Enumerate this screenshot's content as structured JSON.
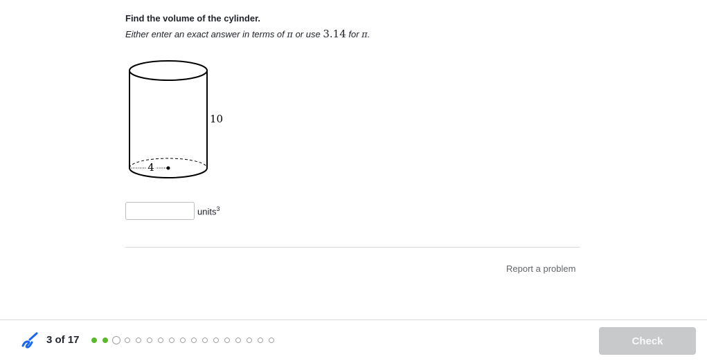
{
  "question": {
    "title": "Find the volume of the cylinder.",
    "instruction_prefix": "Either enter an exact answer in terms of",
    "pi_symbol": "π",
    "instruction_middle": "or use",
    "pi_approx": "3.14",
    "instruction_for": "for",
    "instruction_end": "."
  },
  "figure": {
    "height_label": "10",
    "radius_label": "4"
  },
  "answer": {
    "value": "",
    "placeholder": "",
    "units_label": "units",
    "units_exponent": "3"
  },
  "report_link": "Report a problem",
  "footer": {
    "progress_text": "3 of 17",
    "progress": {
      "current": 3,
      "total": 17,
      "completed": 2
    },
    "check_label": "Check",
    "colors": {
      "completed_dot": "#5cb82f",
      "pending_dot": "#9da0a4",
      "check_disabled": "#c8c9cb",
      "logo_blue": "#1865f2"
    }
  }
}
